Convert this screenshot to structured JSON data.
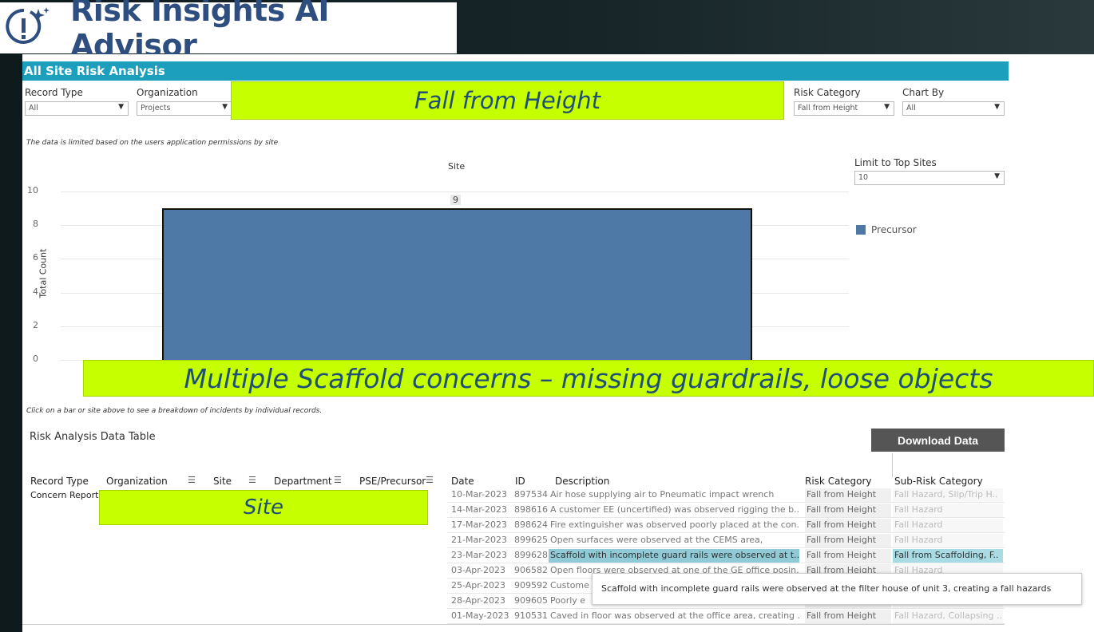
{
  "app": {
    "title": "Risk Insights AI Advisor"
  },
  "dashboard": {
    "title": "All Site Risk Analysis"
  },
  "filters": {
    "record_type": {
      "label": "Record Type",
      "value": "All"
    },
    "organization": {
      "label": "Organization",
      "value": "Projects"
    },
    "risk_category": {
      "label": "Risk Category",
      "value": "Fall from Height"
    },
    "chart_by": {
      "label": "Chart By",
      "value": "All"
    },
    "limit_top_sites": {
      "label": "Limit to Top Sites",
      "value": "10"
    }
  },
  "notes": {
    "permissions": "The data is limited based on the users application permissions by site",
    "click_hint": "Click on a bar or site above to see a breakdown of incidents by individual records."
  },
  "callouts": {
    "top": "Fall from Height",
    "middle": "Multiple Scaffold concerns – missing guardrails, loose objects",
    "site": "Site"
  },
  "chart_data": {
    "type": "bar",
    "title": "Site",
    "ylabel": "Total Count",
    "ylim": [
      0,
      10
    ],
    "yticks": [
      "0",
      "2",
      "4",
      "6",
      "8",
      "10"
    ],
    "series": [
      {
        "name": "Precursor",
        "values": [
          9
        ],
        "color": "#4e79a7"
      }
    ],
    "data_labels": [
      "9"
    ],
    "grid": true,
    "legend": "right"
  },
  "table": {
    "title": "Risk Analysis Data Table",
    "download_label": "Download Data",
    "headers": {
      "record_type": "Record Type",
      "organization": "Organization",
      "site": "Site",
      "department": "Department",
      "pse": "PSE/Precursor",
      "date": "Date",
      "id": "ID",
      "description": "Description",
      "risk_category": "Risk Category",
      "sub_risk": "Sub-Risk Category"
    },
    "record_type_value": "Concern Report",
    "rows": [
      {
        "date": "10-Mar-2023",
        "id": "897534",
        "desc": "Air hose supplying air to Pneumatic impact wrench",
        "risk": "Fall from Height",
        "sub": "Fall Hazard, Slip/Trip H.."
      },
      {
        "date": "14-Mar-2023",
        "id": "898616",
        "desc": "A customer EE (uncertified)  was observed rigging the b..",
        "risk": "Fall from Height",
        "sub": "Fall Hazard"
      },
      {
        "date": "17-Mar-2023",
        "id": "898624",
        "desc": "Fire extinguisher was observed poorly placed at the con..",
        "risk": "Fall from Height",
        "sub": "Fall Hazard"
      },
      {
        "date": "21-Mar-2023",
        "id": "899625",
        "desc": "Open surfaces were observed at the CEMS area,",
        "risk": "Fall from Height",
        "sub": "Fall Hazard"
      },
      {
        "date": "23-Mar-2023",
        "id": "899628",
        "desc": "Scaffold with incomplete guard rails were observed at t..",
        "risk": "Fall from Height",
        "sub": "Fall from Scaffolding, F.."
      },
      {
        "date": "03-Apr-2023",
        "id": "906582",
        "desc": "Open floors were observed at one of the GE office posin..",
        "risk": "Fall from Height",
        "sub": "Fall Hazard"
      },
      {
        "date": "25-Apr-2023",
        "id": "909592",
        "desc": "Custome",
        "risk": "",
        "sub": ""
      },
      {
        "date": "28-Apr-2023",
        "id": "909605",
        "desc": "Poorly e",
        "risk": "",
        "sub": ""
      },
      {
        "date": "01-May-2023",
        "id": "910531",
        "desc": "Caved in floor was observed at the office area, creating ..",
        "risk": "Fall from Height",
        "sub": "Fall Hazard, Collapsing .."
      }
    ],
    "tooltip": "Scaffold with incomplete guard rails were observed at the filter house of unit 3, creating a fall hazards"
  }
}
